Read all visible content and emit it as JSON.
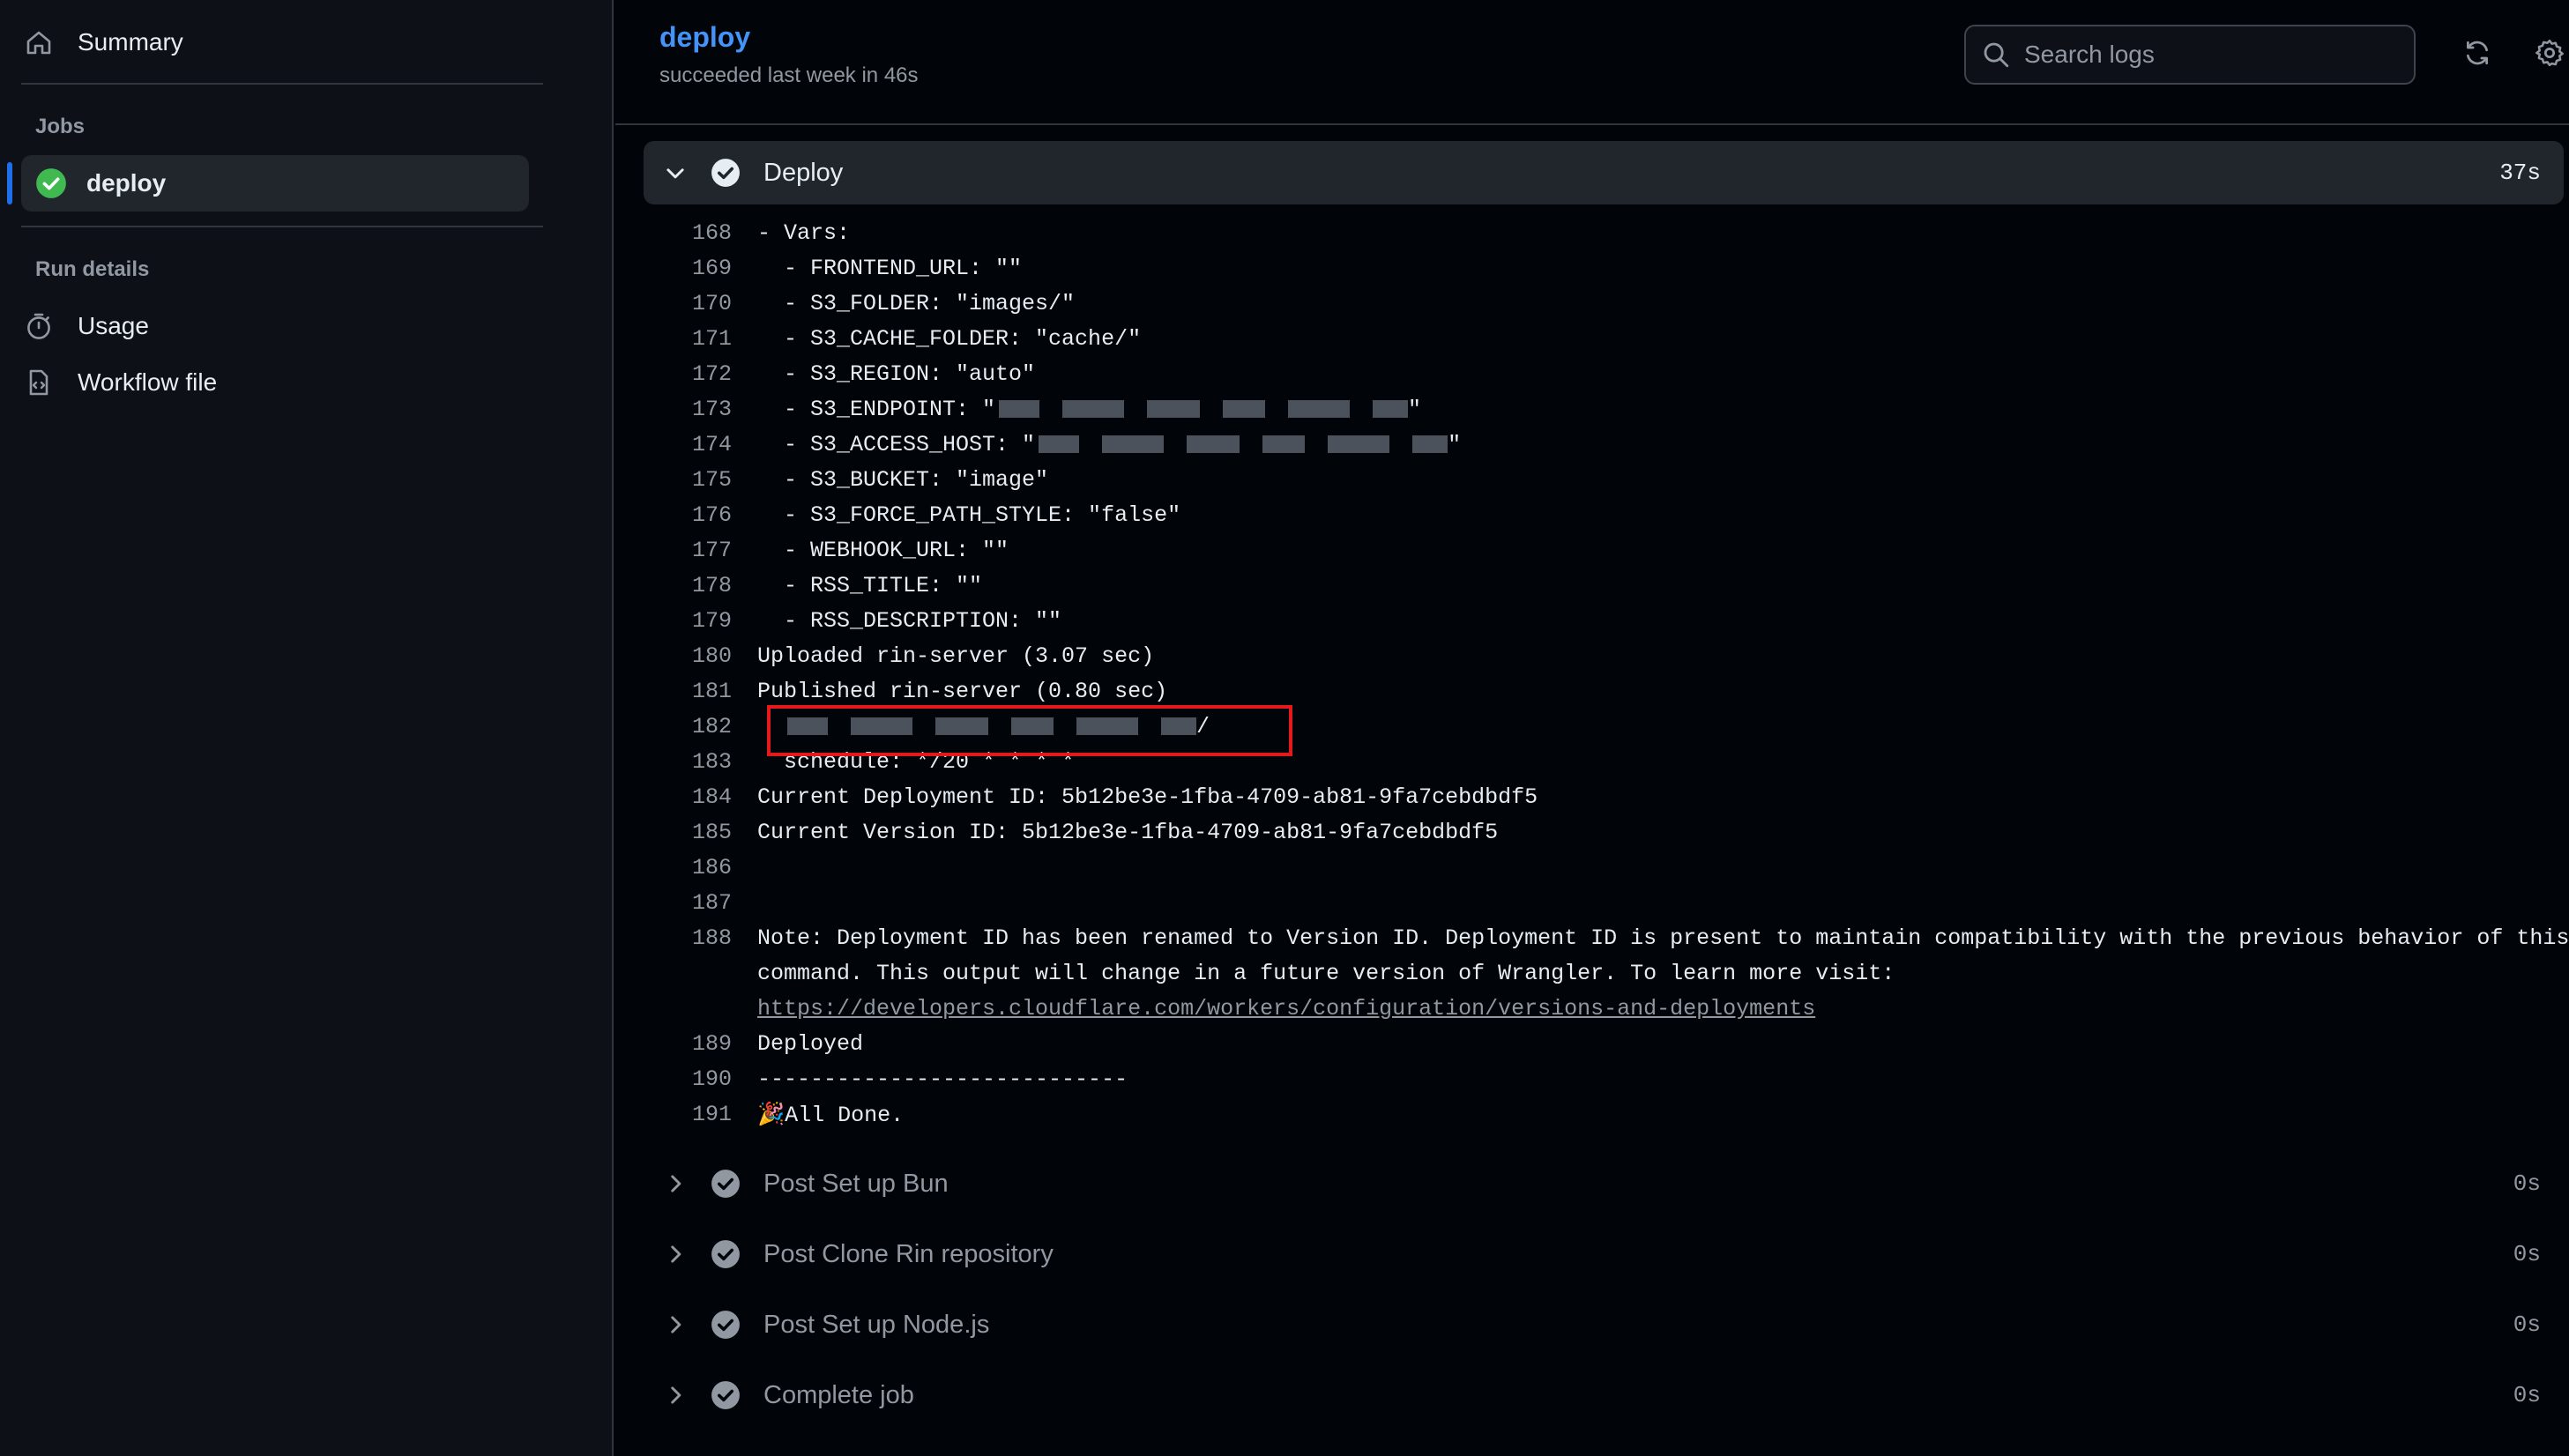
{
  "sidebar": {
    "summary_label": "Summary",
    "jobs_heading": "Jobs",
    "job_label": "deploy",
    "run_details_heading": "Run details",
    "usage_label": "Usage",
    "workflow_label": "Workflow file"
  },
  "header": {
    "job_title": "deploy",
    "job_status": "succeeded last week in 46s",
    "search_placeholder": "Search logs"
  },
  "open_step": {
    "name": "Deploy",
    "duration": "37s"
  },
  "log_lines": [
    {
      "n": "168",
      "t": "- Vars:"
    },
    {
      "n": "169",
      "t": "  - FRONTEND_URL: \"\""
    },
    {
      "n": "170",
      "t": "  - S3_FOLDER: \"images/\""
    },
    {
      "n": "171",
      "t": "  - S3_CACHE_FOLDER: \"cache/\""
    },
    {
      "n": "172",
      "t": "  - S3_REGION: \"auto\""
    },
    {
      "n": "173",
      "t": "  - S3_ENDPOINT: \"",
      "redacted": true,
      "suffix": "\""
    },
    {
      "n": "174",
      "t": "  - S3_ACCESS_HOST: \"",
      "redacted": true,
      "suffix": "\""
    },
    {
      "n": "175",
      "t": "  - S3_BUCKET: \"image\""
    },
    {
      "n": "176",
      "t": "  - S3_FORCE_PATH_STYLE: \"false\""
    },
    {
      "n": "177",
      "t": "  - WEBHOOK_URL: \"\""
    },
    {
      "n": "178",
      "t": "  - RSS_TITLE: \"\""
    },
    {
      "n": "179",
      "t": "  - RSS_DESCRIPTION: \"\""
    },
    {
      "n": "180",
      "t": "Uploaded rin-server (3.07 sec)"
    },
    {
      "n": "181",
      "t": "Published rin-server (0.80 sec)"
    },
    {
      "n": "182",
      "t": "  ",
      "redacted": true,
      "suffix": "/"
    },
    {
      "n": "183",
      "t": "  schedule: */20 * * * *"
    },
    {
      "n": "184",
      "t": "Current Deployment ID: 5b12be3e-1fba-4709-ab81-9fa7cebdbdf5"
    },
    {
      "n": "185",
      "t": "Current Version ID: 5b12be3e-1fba-4709-ab81-9fa7cebdbdf5"
    },
    {
      "n": "186",
      "t": ""
    },
    {
      "n": "187",
      "t": ""
    },
    {
      "n": "188",
      "t": "Note: Deployment ID has been renamed to Version ID. Deployment ID is present to maintain compatibility with the previous behavior of this"
    },
    {
      "n": "",
      "t": "command. This output will change in a future version of Wrangler. To learn more visit:"
    },
    {
      "n": "",
      "t": "https://developers.cloudflare.com/workers/configuration/versions-and-deployments",
      "link": true
    },
    {
      "n": "189",
      "t": "Deployed"
    },
    {
      "n": "190",
      "t": "----------------------------"
    },
    {
      "n": "191",
      "t": "🎉All Done."
    }
  ],
  "steps": [
    {
      "name": "Post Set up Bun",
      "duration": "0s"
    },
    {
      "name": "Post Clone Rin repository",
      "duration": "0s"
    },
    {
      "name": "Post Set up Node.js",
      "duration": "0s"
    },
    {
      "name": "Complete job",
      "duration": "0s"
    }
  ],
  "colors": {
    "accent": "#4493f8",
    "success": "#3fb950",
    "highlight_border": "#e5191d"
  },
  "icons": {
    "summary": "home-icon",
    "job_status": "check-circle-icon",
    "usage": "stopwatch-icon",
    "workflow": "file-code-icon",
    "search": "search-icon",
    "refresh": "sync-icon",
    "settings": "gear-icon"
  }
}
